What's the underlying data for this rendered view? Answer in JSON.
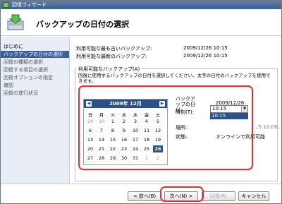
{
  "window": {
    "title": "回復ウィザード"
  },
  "header": {
    "title": "バックアップの日付の選択"
  },
  "sidebar": {
    "items": [
      {
        "label": "はじめに"
      },
      {
        "label": "バックアップの日付の選択"
      },
      {
        "label": "回復の種類の選択"
      },
      {
        "label": "回復する項目の選択"
      },
      {
        "label": "回復オプションの指定"
      },
      {
        "label": "確認"
      },
      {
        "label": "回復の進行状況"
      }
    ]
  },
  "main": {
    "oldest_label": "利用可能な最も古いバックアップ:",
    "oldest_value": "2009/12/26 10:15",
    "newest_label": "利用可能な最新のバックアップ:",
    "newest_value": "2009/12/26 10:15",
    "group_title": "利用可能なバックアップ(A)",
    "group_desc": "回復に使用するバックアップの日付を選択してください。太字の日付のバックアップを使用できます。"
  },
  "calendar": {
    "month_label": "2009年 12月",
    "prev": "◀",
    "next": "▶",
    "weekdays": [
      "日",
      "月",
      "火",
      "水",
      "木",
      "金",
      "土"
    ],
    "days": [
      [
        "29",
        "30",
        "1",
        "2",
        "3",
        "4",
        "5"
      ],
      [
        "6",
        "7",
        "8",
        "9",
        "10",
        "11",
        "12"
      ],
      [
        "13",
        "14",
        "15",
        "16",
        "17",
        "18",
        "19"
      ],
      [
        "20",
        "21",
        "22",
        "23",
        "24",
        "25",
        "26"
      ],
      [
        "27",
        "28",
        "29",
        "30",
        "31",
        "1",
        "2"
      ]
    ],
    "selected": "26"
  },
  "details": {
    "date_label": "バックアップの日付:",
    "date_value": "2009/12/26",
    "time_label": "時刻(T):",
    "time_value": "10:15",
    "time_option": "10:15",
    "location_label": "場所:",
    "location_value": "...5 10:06...",
    "status_label": "状態:",
    "status_value": "オンラインで利用可能"
  },
  "buttons": {
    "back": "< 前へ(B)",
    "next": "次へ(N) >",
    "recover": "回復(R)",
    "cancel": "キャンセル"
  },
  "colors": {
    "highlight": "#e63030",
    "accent": "#2d5089"
  }
}
